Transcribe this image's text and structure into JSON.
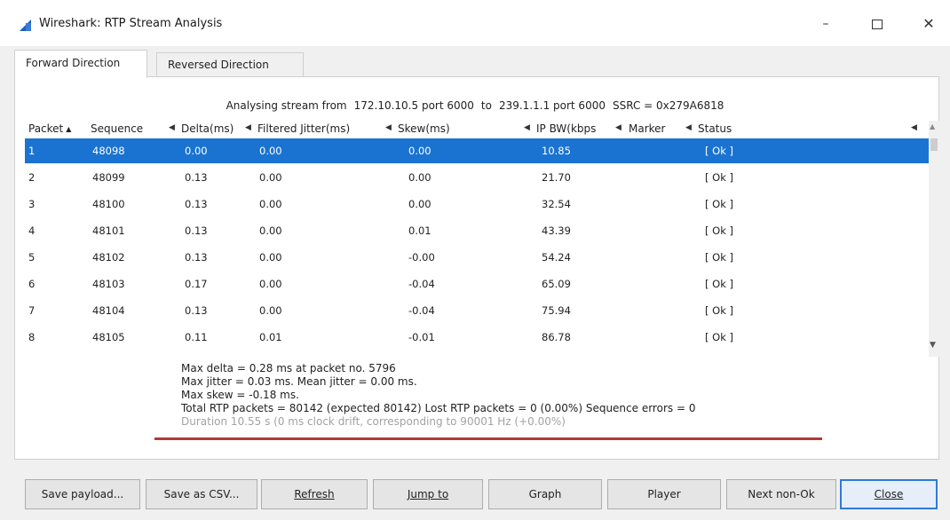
{
  "window": {
    "title": "Wireshark: RTP Stream Analysis",
    "controls": {
      "minimize": "–",
      "maximize": "",
      "close": "✕"
    }
  },
  "tabs": [
    {
      "label": "Forward Direction",
      "active": true
    },
    {
      "label": "Reversed Direction",
      "active": false
    }
  ],
  "stream": {
    "prefix": "Analysing stream from",
    "src": "172.10.10.5 port 6000",
    "to": "to",
    "dst": "239.1.1.1 port 6000",
    "ssrc": "SSRC = 0x279A6818"
  },
  "table": {
    "columns": [
      "Packet",
      "Sequence",
      "Delta(ms)",
      "Filtered Jitter(ms)",
      "Skew(ms)",
      "IP BW(kbps",
      "Marker",
      "Status"
    ],
    "rows": [
      {
        "packet": "1",
        "sequence": "48098",
        "delta": "0.00",
        "jitter": "0.00",
        "skew": "0.00",
        "bw": "10.85",
        "marker": "",
        "status": "[ Ok ]"
      },
      {
        "packet": "2",
        "sequence": "48099",
        "delta": "0.13",
        "jitter": "0.00",
        "skew": "0.00",
        "bw": "21.70",
        "marker": "",
        "status": "[ Ok ]"
      },
      {
        "packet": "3",
        "sequence": "48100",
        "delta": "0.13",
        "jitter": "0.00",
        "skew": "0.00",
        "bw": "32.54",
        "marker": "",
        "status": "[ Ok ]"
      },
      {
        "packet": "4",
        "sequence": "48101",
        "delta": "0.13",
        "jitter": "0.00",
        "skew": "0.01",
        "bw": "43.39",
        "marker": "",
        "status": "[ Ok ]"
      },
      {
        "packet": "5",
        "sequence": "48102",
        "delta": "0.13",
        "jitter": "0.00",
        "skew": "-0.00",
        "bw": "54.24",
        "marker": "",
        "status": "[ Ok ]"
      },
      {
        "packet": "6",
        "sequence": "48103",
        "delta": "0.17",
        "jitter": "0.00",
        "skew": "-0.04",
        "bw": "65.09",
        "marker": "",
        "status": "[ Ok ]"
      },
      {
        "packet": "7",
        "sequence": "48104",
        "delta": "0.13",
        "jitter": "0.00",
        "skew": "-0.04",
        "bw": "75.94",
        "marker": "",
        "status": "[ Ok ]"
      },
      {
        "packet": "8",
        "sequence": "48105",
        "delta": "0.11",
        "jitter": "0.01",
        "skew": "-0.01",
        "bw": "86.78",
        "marker": "",
        "status": "[ Ok ]"
      }
    ],
    "selected_row": 0
  },
  "stats": {
    "max_delta": "Max delta = 0.28 ms at packet no. 5796",
    "jitter": "Max jitter = 0.03 ms. Mean jitter = 0.00 ms.",
    "max_skew": "Max skew = -0.18 ms.",
    "totals": "Total RTP packets = 80142  (expected 80142)   Lost RTP packets = 0 (0.00%)   Sequence errors = 0",
    "duration": "Duration 10.55 s (0 ms clock drift, corresponding to 90001 Hz (+0.00%)"
  },
  "annotation": {
    "underline_color": "#b03b38"
  },
  "colors": {
    "selection": "#1a73d1",
    "accent": "#2f7ad8"
  },
  "buttons": [
    {
      "id": "save-payload",
      "label": "Save payload..."
    },
    {
      "id": "save-csv",
      "label": "Save as CSV..."
    },
    {
      "id": "refresh",
      "label": "Refresh"
    },
    {
      "id": "jump-to",
      "label": "Jump to"
    },
    {
      "id": "graph",
      "label": "Graph"
    },
    {
      "id": "player",
      "label": "Player"
    },
    {
      "id": "next-non-ok",
      "label": "Next non-Ok"
    },
    {
      "id": "close",
      "label": "Close"
    }
  ]
}
